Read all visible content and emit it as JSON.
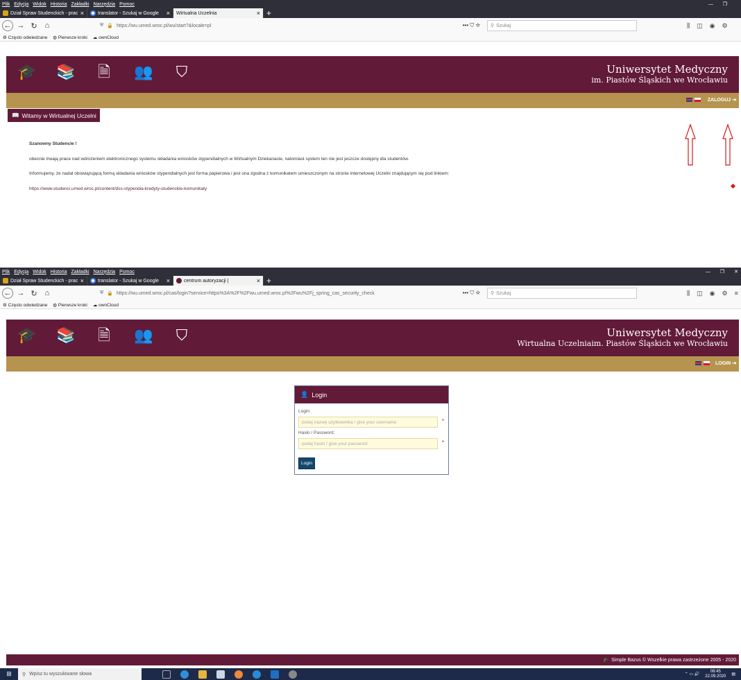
{
  "menu": [
    "Plik",
    "Edycja",
    "Widok",
    "Historia",
    "Zakładki",
    "Narzędzia",
    "Pomoc"
  ],
  "window1": {
    "tabs": [
      {
        "label": "Dział Spraw Studenckich - prac",
        "icon": "shield-icon"
      },
      {
        "label": "translator - Szukaj w Google",
        "icon": "google-icon"
      },
      {
        "label": "Wirtualna Uczelnia",
        "icon": "none",
        "active": true
      }
    ],
    "url": "https://wu.umed.wroc.pl/wu/start?&locale=pl"
  },
  "window2": {
    "tabs": [
      {
        "label": "Dział Spraw Studenckich - prac",
        "icon": "shield-icon"
      },
      {
        "label": "translator - Szukaj w Google",
        "icon": "google-icon"
      },
      {
        "label": "centrum autoryzacji |",
        "icon": "umed-icon",
        "active": true
      }
    ],
    "url": "https://wu.umed.wroc.pl/cas/login?service=https%3A%2F%2Fwu.umed.wroc.pl%2Fwu%2Fj_spring_cas_security_check"
  },
  "search_placeholder": "Szukaj",
  "bookmarks": [
    "Często odwiedzane",
    "Pierwsze kroki",
    "ownCloud"
  ],
  "site1": {
    "univ_line1": "Uniwersytet Medyczny",
    "univ_line2": "im. Piastów Śląskich we Wrocławiu",
    "login_link": "ZALOGUJ",
    "welcome": "Witamy w Wirtualnej Uczelni",
    "greeting": "Szanowny Studencie !",
    "para1": "obecnie trwają prace nad wdrożeniem elektronicznego systemu składania wniosków stypendialnych w Wirtualnym Dziekanacie, natomiast system ten nie jest jeszcze dostępny dla studentów.",
    "para2": "Informujemy, że nadal obowiązującą formą składania wniosków stypendialnych jest forma papierowa i jest ona zgodna z komunikatem umieszczonym na stronie internetowej Uczelni znajdującym się pod linkiem:",
    "link": "https://www.studenci.umed.wroc.pl/content/dss-stypendia-kredyty-studenckie-komunikaty"
  },
  "site2": {
    "univ_line1": "Uniwersytet Medyczny",
    "univ_line2": "Wirtualna Uczelniaim. Piastów Śląskich we Wrocławiu",
    "login_link": "LOGIN",
    "login_box": {
      "title": "Login",
      "login_label": "Login:",
      "login_placeholder": "podaj nazwę użytkownika / give your username",
      "password_label": "Hasło / Password:",
      "password_placeholder": "podaj hasło / give your password",
      "button": "Login"
    },
    "footer": "Simple Bazus © Wszelkie prawa zastrzeżone 2005 - 2020"
  },
  "taskbar": {
    "search": "Wpisz tu wyszukiwane słowa",
    "time": "08:45",
    "date": "22.09.2020"
  },
  "colors": {
    "brand_maroon": "#611a37",
    "gold": "#b6944f",
    "login_button": "#13476e",
    "arrow_red": "#d11a1a"
  }
}
